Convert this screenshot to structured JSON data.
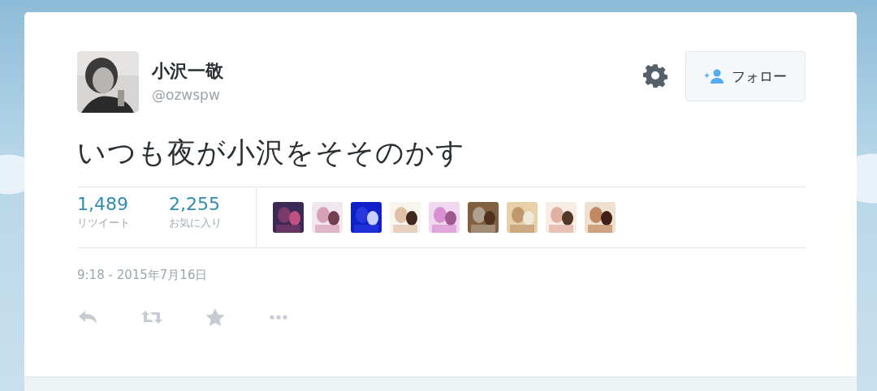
{
  "tweet": {
    "author": {
      "name": "小沢一敬",
      "handle": "@ozwspw"
    },
    "follow_button": {
      "label": "フォロー"
    },
    "text": "いつも夜が小沢をそそのかす",
    "stats": [
      {
        "count": "1,489",
        "label": "リツイート"
      },
      {
        "count": "2,255",
        "label": "お気に入り"
      }
    ],
    "timestamp": "9:18 - 2015年7月16日"
  }
}
